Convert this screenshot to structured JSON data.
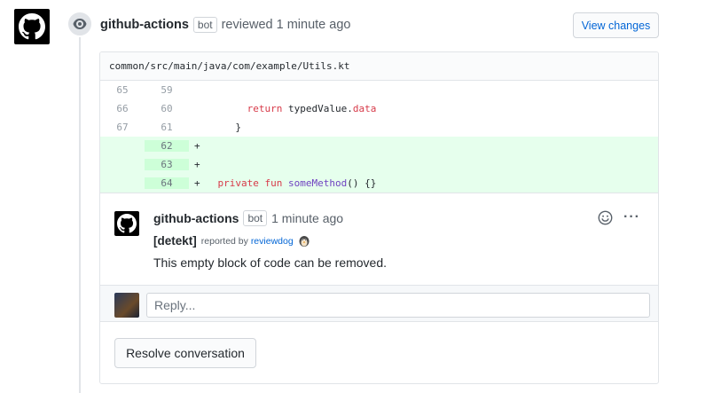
{
  "review": {
    "author": "github-actions",
    "badge": "bot",
    "action": "reviewed 1 minute ago",
    "view_changes_label": "View changes",
    "avatar_icon": "github-octocat-icon"
  },
  "file": {
    "path": "common/src/main/java/com/example/Utils.kt"
  },
  "diff": {
    "rows": [
      {
        "old": "65",
        "new": "59",
        "marker": "",
        "type": "context"
      },
      {
        "old": "66",
        "new": "60",
        "marker": "",
        "type": "context"
      },
      {
        "old": "67",
        "new": "61",
        "marker": "",
        "type": "context"
      },
      {
        "old": "",
        "new": "62",
        "marker": "+",
        "type": "add"
      },
      {
        "old": "",
        "new": "63",
        "marker": "+",
        "type": "add"
      },
      {
        "old": "",
        "new": "64",
        "marker": "+",
        "type": "add"
      }
    ],
    "line60_kw": "return",
    "line60_text": " typedValue.",
    "line60_prop": "data",
    "line61_text": "}",
    "line64_kw1": "private",
    "line64_kw2": "fun",
    "line64_fn": "someMethod",
    "line64_rest": "() {}"
  },
  "comment": {
    "author": "github-actions",
    "badge": "bot",
    "time": "1 minute ago",
    "tag": "[detekt]",
    "reported_by": "reported by",
    "reporter": "reviewdog",
    "body": "This empty block of code can be removed.",
    "more_label": "···"
  },
  "reply": {
    "placeholder": "Reply..."
  },
  "resolve": {
    "label": "Resolve conversation"
  },
  "colors": {
    "link": "#0366d6",
    "addition_bg": "#e6ffed",
    "addition_gutter": "#cdffd8",
    "keyword": "#d73a49",
    "function": "#6f42c1"
  }
}
